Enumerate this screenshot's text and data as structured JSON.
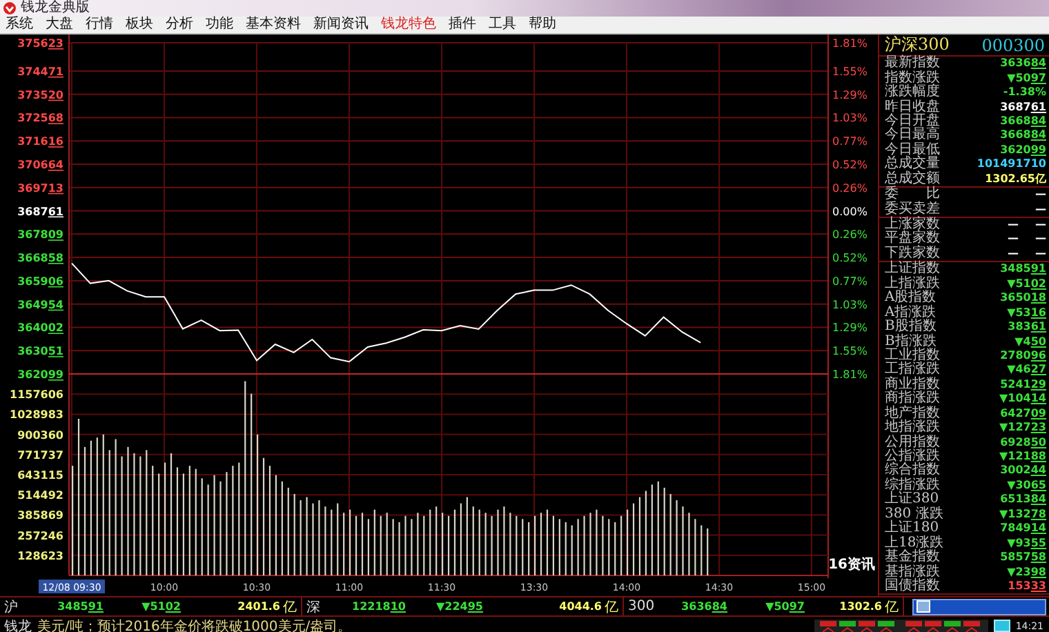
{
  "window": {
    "title": "钱龙金典版"
  },
  "menu": [
    {
      "label": "系统",
      "selected": false
    },
    {
      "label": "大盘",
      "selected": false
    },
    {
      "label": "行情",
      "selected": false
    },
    {
      "label": "板块",
      "selected": false
    },
    {
      "label": "分析",
      "selected": false
    },
    {
      "label": "功能",
      "selected": false
    },
    {
      "label": "基本资料",
      "selected": false
    },
    {
      "label": "新闻资讯",
      "selected": false
    },
    {
      "label": "钱龙特色",
      "selected": true
    },
    {
      "label": "插件",
      "selected": false
    },
    {
      "label": "工具",
      "selected": false
    },
    {
      "label": "帮助",
      "selected": false
    }
  ],
  "price_chart": {
    "chart_data": {
      "type": "line",
      "grid": true,
      "ylim": [
        362099,
        375623
      ],
      "categories": [
        null,
        null,
        null,
        null,
        null,
        null,
        null,
        null,
        null,
        null,
        null,
        null,
        null,
        null,
        null,
        null,
        null,
        null,
        null,
        null,
        null,
        null,
        null,
        null,
        null,
        null,
        null,
        null,
        null,
        null,
        null,
        null,
        null,
        null,
        null,
        null,
        null,
        null,
        null,
        null,
        null
      ],
      "series": [
        {
          "name": "沪深300",
          "color": "#ffffff",
          "values": [
            366620,
            365800,
            365910,
            365490,
            365250,
            365250,
            363940,
            364290,
            363870,
            363890,
            362650,
            363310,
            362980,
            363510,
            362760,
            362600,
            363200,
            363360,
            363600,
            363900,
            363870,
            364070,
            363930,
            364690,
            365360,
            365520,
            365520,
            365730,
            365360,
            364690,
            364150,
            363660,
            364420,
            363810,
            363380,
            null,
            null,
            null,
            null,
            null,
            null
          ]
        }
      ],
      "yticks": [
        {
          "value": 375623,
          "label": "375623"
        },
        {
          "value": 374471,
          "label": "374471"
        },
        {
          "value": 373520,
          "label": "373520"
        },
        {
          "value": 372568,
          "label": "372568"
        },
        {
          "value": 371616,
          "label": "371616"
        },
        {
          "value": 370664,
          "label": "370664"
        },
        {
          "value": 369713,
          "label": "369713"
        },
        {
          "value": 368761,
          "label": "368761"
        },
        {
          "value": 367809,
          "label": "367809"
        },
        {
          "value": 366858,
          "label": "366858"
        },
        {
          "value": 365906,
          "label": "365906"
        },
        {
          "value": 364954,
          "label": "364954"
        },
        {
          "value": 364002,
          "label": "364002"
        },
        {
          "value": 363051,
          "label": "363051"
        },
        {
          "value": 362099,
          "label": "362099"
        }
      ]
    },
    "percent_ticks": [
      {
        "label": "1.81%",
        "color": "#ff4848"
      },
      {
        "label": "1.55%",
        "color": "#ff4848"
      },
      {
        "label": "1.29%",
        "color": "#ff4848"
      },
      {
        "label": "1.03%",
        "color": "#ff4848"
      },
      {
        "label": "0.77%",
        "color": "#ff4848"
      },
      {
        "label": "0.52%",
        "color": "#ff4848"
      },
      {
        "label": "0.26%",
        "color": "#ff4848"
      },
      {
        "label": "0.00%",
        "color": "#ffffff"
      },
      {
        "label": "0.26%",
        "color": "#3ce03c"
      },
      {
        "label": "0.52%",
        "color": "#3ce03c"
      },
      {
        "label": "0.77%",
        "color": "#3ce03c"
      },
      {
        "label": "1.03%",
        "color": "#3ce03c"
      },
      {
        "label": "1.29%",
        "color": "#3ce03c"
      },
      {
        "label": "1.55%",
        "color": "#3ce03c"
      },
      {
        "label": "1.81%",
        "color": "#3ce03c"
      }
    ]
  },
  "volume_chart": {
    "chart_data": {
      "type": "bar",
      "grid": true,
      "ylim": [
        0,
        1286230
      ],
      "categories": [
        "12/08 09:30",
        null,
        null,
        null,
        null,
        null,
        null,
        null,
        null,
        null,
        null,
        null,
        null,
        null,
        null,
        "10:00",
        null,
        null,
        null,
        null,
        null,
        null,
        null,
        null,
        null,
        null,
        null,
        null,
        null,
        null,
        "10:30",
        null,
        null,
        null,
        null,
        null,
        null,
        null,
        null,
        null,
        null,
        null,
        null,
        null,
        null,
        "11:00",
        null,
        null,
        null,
        null,
        null,
        null,
        null,
        null,
        null,
        null,
        null,
        null,
        null,
        null,
        "11:30",
        null,
        null,
        null,
        null,
        null,
        null,
        null,
        null,
        null,
        null,
        null,
        null,
        null,
        null,
        "13:30",
        null,
        null,
        null,
        null,
        null,
        null,
        null,
        null,
        null,
        null,
        null,
        null,
        null,
        null,
        "14:00",
        null,
        null,
        null,
        null,
        null,
        null,
        null,
        null,
        null,
        null,
        null,
        null,
        null,
        null,
        "14:30",
        null,
        null,
        null,
        null,
        null,
        null,
        null,
        null,
        null,
        null,
        null,
        null,
        null,
        null,
        "15:00"
      ],
      "values": [
        700000,
        1000000,
        820000,
        860000,
        880000,
        900000,
        800000,
        870000,
        760000,
        820000,
        780000,
        760000,
        800000,
        700000,
        650000,
        720000,
        780000,
        690000,
        650000,
        700000,
        680000,
        620000,
        580000,
        640000,
        600000,
        660000,
        700000,
        720000,
        1240000,
        1160000,
        900000,
        750000,
        700000,
        640000,
        600000,
        560000,
        520000,
        480000,
        500000,
        460000,
        480000,
        440000,
        420000,
        460000,
        400000,
        420000,
        380000,
        400000,
        360000,
        420000,
        380000,
        400000,
        360000,
        340000,
        380000,
        360000,
        400000,
        380000,
        420000,
        440000,
        400000,
        380000,
        420000,
        460000,
        500000,
        440000,
        420000,
        400000,
        380000,
        420000,
        440000,
        400000,
        380000,
        360000,
        340000,
        380000,
        400000,
        420000,
        380000,
        360000,
        340000,
        320000,
        360000,
        380000,
        400000,
        420000,
        380000,
        360000,
        340000,
        380000,
        420000,
        460000,
        500000,
        540000,
        580000,
        600000,
        560000,
        520000,
        480000,
        440000,
        400000,
        360000,
        320000,
        300000,
        null,
        null,
        null,
        null,
        null,
        null,
        null,
        null,
        null,
        null,
        null,
        null,
        null,
        null,
        null,
        null,
        null
      ],
      "yticks": [
        {
          "value": 1157606,
          "label": "1157606"
        },
        {
          "value": 1028983,
          "label": "1028983"
        },
        {
          "value": 900360,
          "label": "900360"
        },
        {
          "value": 771737,
          "label": "771737"
        },
        {
          "value": 643115,
          "label": "643115"
        },
        {
          "value": 514492,
          "label": "514492"
        },
        {
          "value": 385869,
          "label": "385869"
        },
        {
          "value": 257246,
          "label": "257246"
        },
        {
          "value": 128623,
          "label": "128623"
        }
      ]
    }
  },
  "news_badge": "16资讯",
  "quote_panel": {
    "code": "000300",
    "sections": [
      [
        {
          "label": "最新指数",
          "values": [
            "363684"
          ],
          "color": "#3ce03c",
          "underlined": true
        },
        {
          "label": "指数涨跌",
          "values": [
            "▼5097"
          ],
          "color": "#3ce03c",
          "underlined": true
        },
        {
          "label": "涨跌幅度",
          "values": [
            "-1.38%"
          ],
          "color": "#3ce03c",
          "underlined": false
        },
        {
          "label": "昨日收盘",
          "values": [
            "368761"
          ],
          "color": "#ffffff",
          "underlined": true
        },
        {
          "label": "今日开盘",
          "values": [
            "366884"
          ],
          "color": "#3ce03c",
          "underlined": true
        },
        {
          "label": "今日最高",
          "values": [
            "366884"
          ],
          "color": "#3ce03c",
          "underlined": true
        },
        {
          "label": "今日最低",
          "values": [
            "362099"
          ],
          "color": "#3ce03c",
          "underlined": true
        },
        {
          "label": "总成交量",
          "values": [
            "101491710"
          ],
          "color": "#40d0ff",
          "underlined": false
        },
        {
          "label": "总成交额",
          "values": [
            "1302.65亿"
          ],
          "color": "#ffff70",
          "underlined": false
        }
      ],
      [
        {
          "label": "委　　比",
          "values": [
            "—"
          ],
          "color": "#ffffff",
          "underlined": false
        },
        {
          "label": "委买卖差",
          "values": [
            "—"
          ],
          "color": "#ffffff",
          "underlined": false
        }
      ],
      [
        {
          "label": "上涨家数",
          "values": [
            "—",
            "—"
          ],
          "color": "#ffffff",
          "underlined": false
        },
        {
          "label": "平盘家数",
          "values": [
            "—",
            "—"
          ],
          "color": "#ffffff",
          "underlined": false
        },
        {
          "label": "下跌家数",
          "values": [
            "—",
            "—"
          ],
          "color": "#ffffff",
          "underlined": false
        }
      ],
      [
        {
          "label": "上证指数",
          "values": [
            "348591"
          ],
          "color": "#3ce03c",
          "underlined": true
        },
        {
          "label": "上指涨跌",
          "values": [
            "▼5102"
          ],
          "color": "#3ce03c",
          "underlined": true
        },
        {
          "label": "A股指数",
          "values": [
            "365018"
          ],
          "color": "#3ce03c",
          "underlined": true
        },
        {
          "label": "A指涨跌",
          "values": [
            "▼5316"
          ],
          "color": "#3ce03c",
          "underlined": true
        },
        {
          "label": "B股指数",
          "values": [
            "38361"
          ],
          "color": "#3ce03c",
          "underlined": true
        },
        {
          "label": "B指涨跌",
          "values": [
            "▼450"
          ],
          "color": "#3ce03c",
          "underlined": true
        },
        {
          "label": "工业指数",
          "values": [
            "278096"
          ],
          "color": "#3ce03c",
          "underlined": true
        },
        {
          "label": "工指涨跌",
          "values": [
            "▼4627"
          ],
          "color": "#3ce03c",
          "underlined": true
        },
        {
          "label": "商业指数",
          "values": [
            "524129"
          ],
          "color": "#3ce03c",
          "underlined": true
        },
        {
          "label": "商指涨跌",
          "values": [
            "▼10414"
          ],
          "color": "#3ce03c",
          "underlined": true
        },
        {
          "label": "地产指数",
          "values": [
            "642709"
          ],
          "color": "#3ce03c",
          "underlined": true
        },
        {
          "label": "地指涨跌",
          "values": [
            "▼12723"
          ],
          "color": "#3ce03c",
          "underlined": true
        },
        {
          "label": "公用指数",
          "values": [
            "692850"
          ],
          "color": "#3ce03c",
          "underlined": true
        },
        {
          "label": "公指涨跌",
          "values": [
            "▼12188"
          ],
          "color": "#3ce03c",
          "underlined": true
        },
        {
          "label": "综合指数",
          "values": [
            "300244"
          ],
          "color": "#3ce03c",
          "underlined": true
        },
        {
          "label": "综指涨跌",
          "values": [
            "▼3065"
          ],
          "color": "#3ce03c",
          "underlined": true
        },
        {
          "label": "上证380",
          "values": [
            "651384"
          ],
          "color": "#3ce03c",
          "underlined": true
        },
        {
          "label": "380 涨跌",
          "values": [
            "▼13278"
          ],
          "color": "#3ce03c",
          "underlined": true
        },
        {
          "label": "上证180",
          "values": [
            "784914"
          ],
          "color": "#3ce03c",
          "underlined": true
        },
        {
          "label": "上18涨跌",
          "values": [
            "▼9355"
          ],
          "color": "#3ce03c",
          "underlined": true
        },
        {
          "label": "基金指数",
          "values": [
            "585758"
          ],
          "color": "#3ce03c",
          "underlined": true
        },
        {
          "label": "基指涨跌",
          "values": [
            "▼2398"
          ],
          "color": "#3ce03c",
          "underlined": true
        },
        {
          "label": "国债指数",
          "values": [
            "15333"
          ],
          "color": "#ff4848",
          "underlined": true
        }
      ]
    ]
  },
  "index_bar": [
    {
      "market": "沪",
      "index": "348591",
      "change": "▼5102",
      "amount": "2401.6",
      "unit": "亿"
    },
    {
      "market": "深",
      "index": "1221810",
      "change": "▼22495",
      "amount": "4044.6",
      "unit": "亿"
    },
    {
      "market": "300",
      "index": "363684",
      "change": "▼5097",
      "amount": "1302.6",
      "unit": "亿"
    }
  ],
  "ticker": {
    "source": "钱龙",
    "text": "美元/吨；预计2016年金价将跌破1000美元/盎司。"
  },
  "clock": "14:21"
}
